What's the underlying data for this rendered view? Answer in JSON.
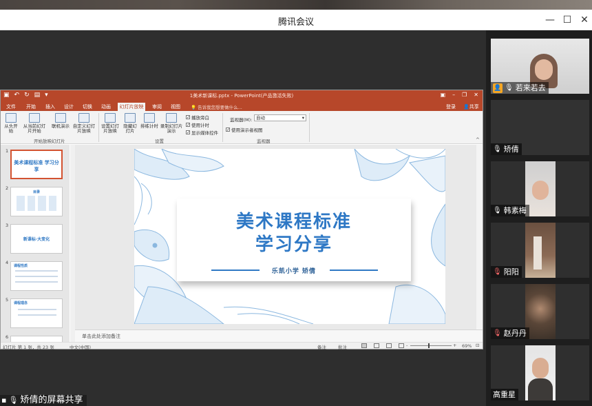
{
  "window": {
    "title": "腾讯会议",
    "minimize": "—",
    "maximize": "☐",
    "close": "✕"
  },
  "share": {
    "label": "矫倩的屏幕共享"
  },
  "ppt": {
    "doc_title": "1美术新课标.pptx - PowerPoint(产品激活失败)",
    "tabs": [
      "文件",
      "开始",
      "插入",
      "设计",
      "切换",
      "动画",
      "幻灯片放映",
      "审阅",
      "视图"
    ],
    "active_tab": "幻灯片放映",
    "tell_me": "告诉我您想要做什么...",
    "login": "登录",
    "share": "共享",
    "ribbon": {
      "from_start": "从头开始",
      "from_current": "从当前幻灯片开始",
      "online": "联机演示",
      "custom": "自定义幻灯片放映",
      "setup": "设置幻灯片放映",
      "hide": "隐藏幻灯片",
      "rehearse": "排练计时",
      "record": "录制幻灯片演示",
      "chk_narration": "播放旁白",
      "chk_timing": "使用计时",
      "chk_media": "显示媒体控件",
      "monitor_label": "监视器(M):",
      "monitor_value": "自动",
      "chk_presenter": "使用演示者视图",
      "group_start": "开始放映幻灯片",
      "group_setup": "设置",
      "group_monitor": "监视器"
    },
    "thumbs": [
      {
        "num": "1",
        "text": "美术课程标准 学习分享"
      },
      {
        "num": "2",
        "text": "目录"
      },
      {
        "num": "3",
        "text": "新课标·大变化"
      },
      {
        "num": "4",
        "text": "课程性质"
      },
      {
        "num": "5",
        "text": "课程理念"
      },
      {
        "num": "6",
        "text": ""
      }
    ],
    "slide": {
      "title_line1": "美术课程标准",
      "title_line2": "学习分享",
      "subtitle": "乐凯小学  矫倩"
    },
    "notes_placeholder": "单击此处添加备注",
    "status": {
      "slide_pos": "幻灯片 第 1 张，共 23 张",
      "language": "中文(中国)",
      "notes": "备注",
      "comments": "批注",
      "zoom": "69%"
    }
  },
  "participants": [
    {
      "name": "若来若去",
      "mic": "on",
      "video": true,
      "host_icon": true
    },
    {
      "name": "矫倩",
      "mic": "on",
      "video": false
    },
    {
      "name": "韩素梅",
      "mic": "on",
      "video": true
    },
    {
      "name": "阳阳",
      "mic": "muted",
      "video": true
    },
    {
      "name": "赵丹丹",
      "mic": "muted",
      "video": true
    },
    {
      "name": "高重星",
      "mic": "none",
      "video": true
    }
  ]
}
